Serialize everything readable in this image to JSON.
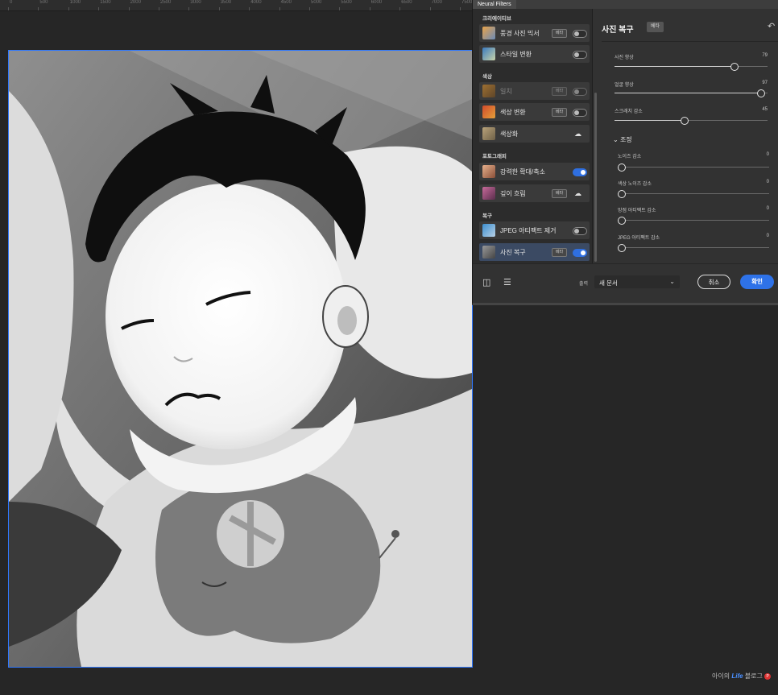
{
  "ruler": {
    "ticks": [
      "0",
      "500",
      "1000",
      "1500",
      "2000",
      "2500",
      "3000",
      "3500",
      "4000",
      "4500",
      "5000",
      "5500",
      "6000",
      "6500",
      "7000",
      "7500"
    ]
  },
  "panel": {
    "title": "Neural Filters",
    "categories": {
      "creative": "크리에이티브",
      "color": "색상",
      "photography": "포토그래피",
      "restoration": "복구"
    },
    "beta_label": "베타",
    "filters": [
      {
        "label": "풍경 사진 믹서",
        "beta": true,
        "control": "toggle",
        "on": false
      },
      {
        "label": "스타일 변환",
        "beta": false,
        "control": "toggle",
        "on": false
      },
      {
        "label": "일치",
        "beta": true,
        "control": "toggle",
        "on": false,
        "dim": true
      },
      {
        "label": "색상 변환",
        "beta": true,
        "control": "toggle",
        "on": false
      },
      {
        "label": "색상화",
        "beta": false,
        "control": "download"
      },
      {
        "label": "강력한 확대/축소",
        "beta": false,
        "control": "toggle",
        "on": true
      },
      {
        "label": "깊이 흐림",
        "beta": true,
        "control": "download"
      },
      {
        "label": "JPEG 아티팩트 제거",
        "beta": false,
        "control": "toggle",
        "on": false
      },
      {
        "label": "사진 복구",
        "beta": true,
        "control": "toggle",
        "on": true,
        "selected": true
      }
    ]
  },
  "detail": {
    "title": "사진 복구",
    "beta": "베타",
    "sliders": [
      {
        "label": "사진 향상",
        "value": "79",
        "fraction": 0.79
      },
      {
        "label": "얼굴 향상",
        "value": "97",
        "fraction": 0.97
      },
      {
        "label": "스크래치 감소",
        "value": "45",
        "fraction": 0.45
      }
    ],
    "adjust_section": "조정",
    "adjust_sliders": [
      {
        "label": "노이즈 감소",
        "value": "0",
        "fraction": 0
      },
      {
        "label": "색상 노이즈 감소",
        "value": "0",
        "fraction": 0
      },
      {
        "label": "망점 아티팩트 감소",
        "value": "0",
        "fraction": 0
      },
      {
        "label": "JPEG 아티팩트 감소",
        "value": "0",
        "fraction": 0
      }
    ]
  },
  "footer": {
    "output_label": "출력",
    "output_value": "새 문서",
    "cancel": "취소",
    "ok": "확인"
  },
  "watermark": {
    "prefix": "아이의",
    "brand": "Life",
    "suffix": "블로그"
  }
}
